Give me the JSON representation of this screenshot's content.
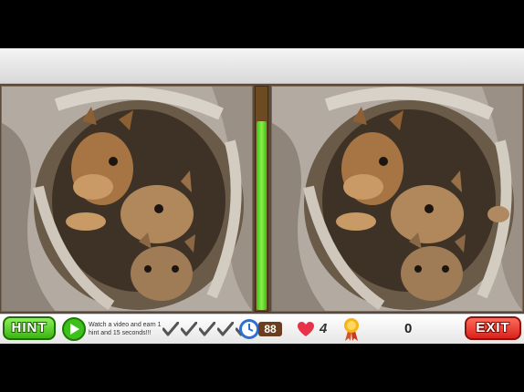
{
  "hud": {
    "hint_label": "HINT",
    "video_offer_text": "Watch a video and earn 1 hint and 15 seconds!!!",
    "differences_total": 5,
    "time_remaining": "88",
    "lives": "4",
    "score": "0",
    "exit_label": "EXIT",
    "timer_fraction": 0.85
  },
  "icons": {
    "video": "play-icon",
    "found_marker": "checkmark-icon",
    "timer": "stopwatch-icon",
    "lives": "heart-icon",
    "achievement": "medal-icon"
  },
  "colors": {
    "hint_button": "#3db512",
    "exit_button": "#d9231c",
    "timer_fill": "#52d125",
    "time_badge": "#6b3e20",
    "heart": "#e8324a"
  }
}
